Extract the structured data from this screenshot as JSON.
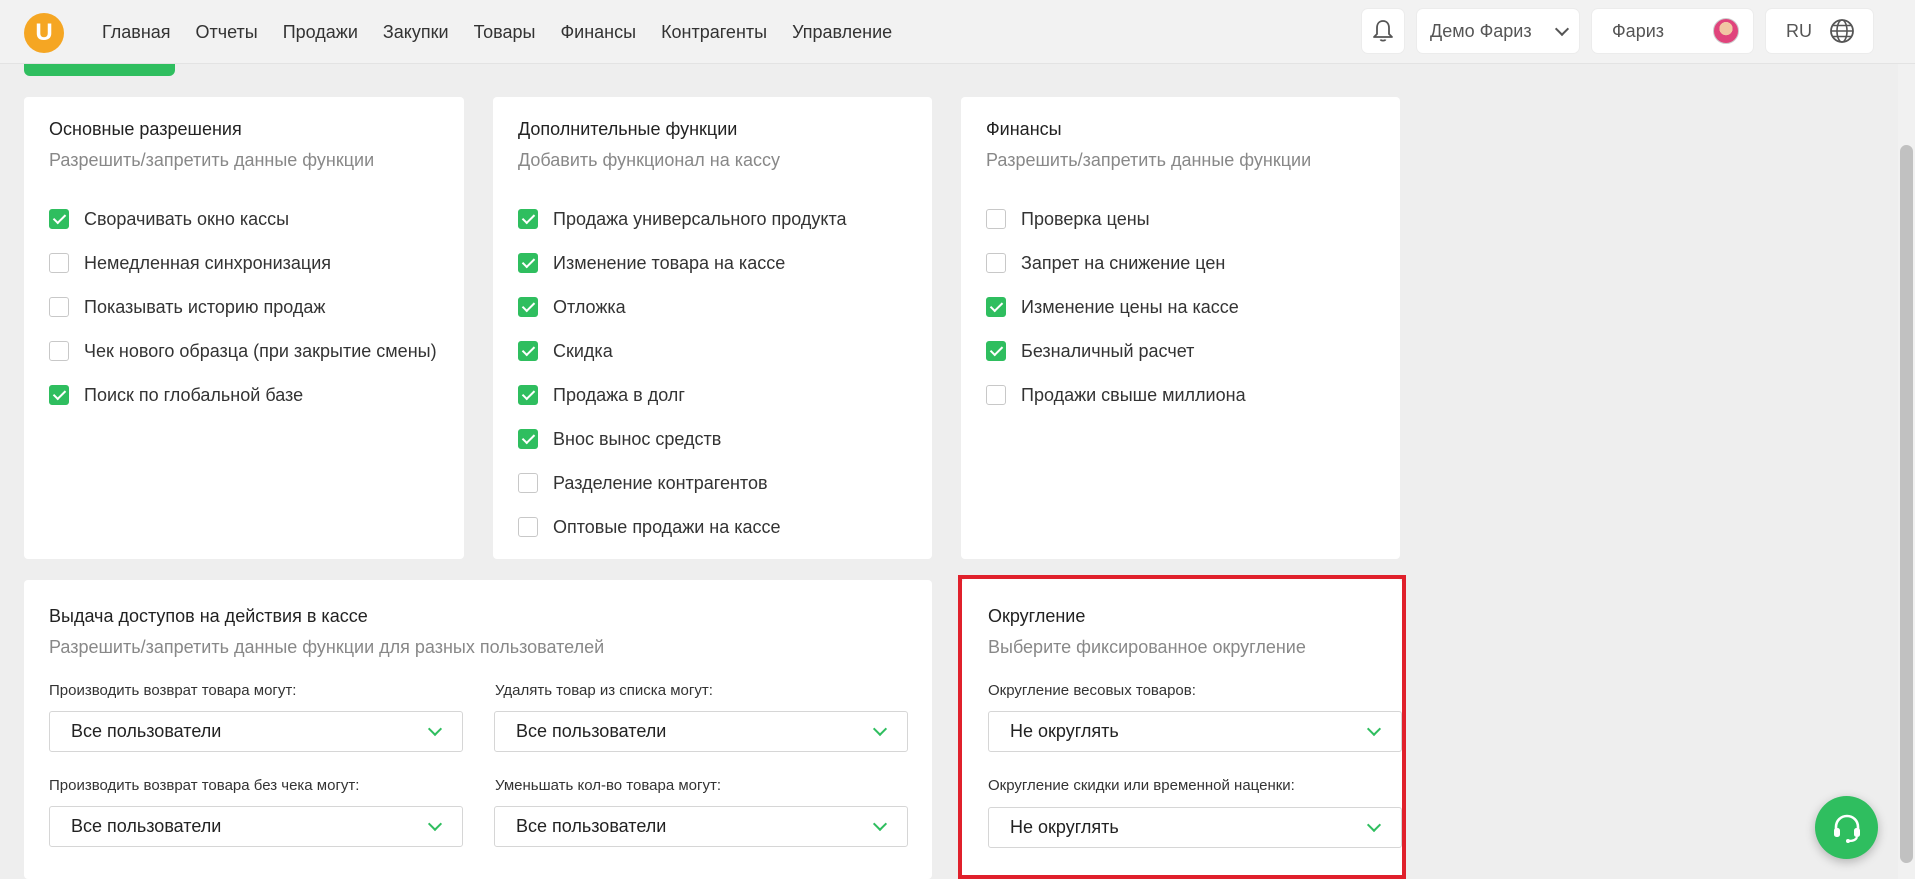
{
  "header": {
    "logo_letter": "U",
    "nav": [
      "Главная",
      "Отчеты",
      "Продажи",
      "Закупки",
      "Товары",
      "Финансы",
      "Контрагенты",
      "Управление"
    ],
    "company": "Демо Фариз",
    "user": "Фариз",
    "language": "RU"
  },
  "cards": {
    "basic": {
      "title": "Основные разрешения",
      "subtitle": "Разрешить/запретить данные функции",
      "items": [
        {
          "label": "Сворачивать окно кассы",
          "checked": true
        },
        {
          "label": "Немедленная синхронизация",
          "checked": false
        },
        {
          "label": "Показывать историю продаж",
          "checked": false
        },
        {
          "label": "Чек нового образца (при закрытие смены)",
          "checked": false
        },
        {
          "label": "Поиск по глобальной базе",
          "checked": true
        }
      ]
    },
    "extra": {
      "title": "Дополнительные функции",
      "subtitle": "Добавить функционал на кассу",
      "items": [
        {
          "label": "Продажа универсального продукта",
          "checked": true
        },
        {
          "label": "Изменение товара на кассе",
          "checked": true
        },
        {
          "label": "Отложка",
          "checked": true
        },
        {
          "label": "Скидка",
          "checked": true
        },
        {
          "label": "Продажа в долг",
          "checked": true
        },
        {
          "label": "Внос вынос средств",
          "checked": true
        },
        {
          "label": "Разделение контрагентов",
          "checked": false
        },
        {
          "label": "Оптовые продажи на кассе",
          "checked": false
        }
      ]
    },
    "finance": {
      "title": "Финансы",
      "subtitle": "Разрешить/запретить данные функции",
      "items": [
        {
          "label": "Проверка цены",
          "checked": false
        },
        {
          "label": "Запрет на снижение цен",
          "checked": false
        },
        {
          "label": "Изменение цены на кассе",
          "checked": true
        },
        {
          "label": "Безналичный расчет",
          "checked": true
        },
        {
          "label": "Продажи свыше миллиона",
          "checked": false
        }
      ]
    },
    "access": {
      "title": "Выдача доступов на действия в кассе",
      "subtitle": "Разрешить/запретить данные функции для разных пользователей",
      "fields": [
        {
          "label": "Производить возврат товара могут:",
          "value": "Все пользователи"
        },
        {
          "label": "Удалять товар из списка могут:",
          "value": "Все пользователи"
        },
        {
          "label": "Производить возврат товара без чека могут:",
          "value": "Все пользователи"
        },
        {
          "label": "Уменьшать кол-во товара могут:",
          "value": "Все пользователи"
        }
      ]
    },
    "rounding": {
      "title": "Округление",
      "subtitle": "Выберите фиксированное округление",
      "fields": [
        {
          "label": "Округление весовых товаров:",
          "value": "Не округлять"
        },
        {
          "label": "Округление скидки или временной наценки:",
          "value": "Не округлять"
        }
      ]
    }
  },
  "colors": {
    "accent": "#2fbe5f",
    "highlight": "#e0202b",
    "logo": "#f5a623"
  },
  "icons": [
    "bell-icon",
    "chevron-down-icon",
    "globe-icon",
    "headset-icon"
  ]
}
